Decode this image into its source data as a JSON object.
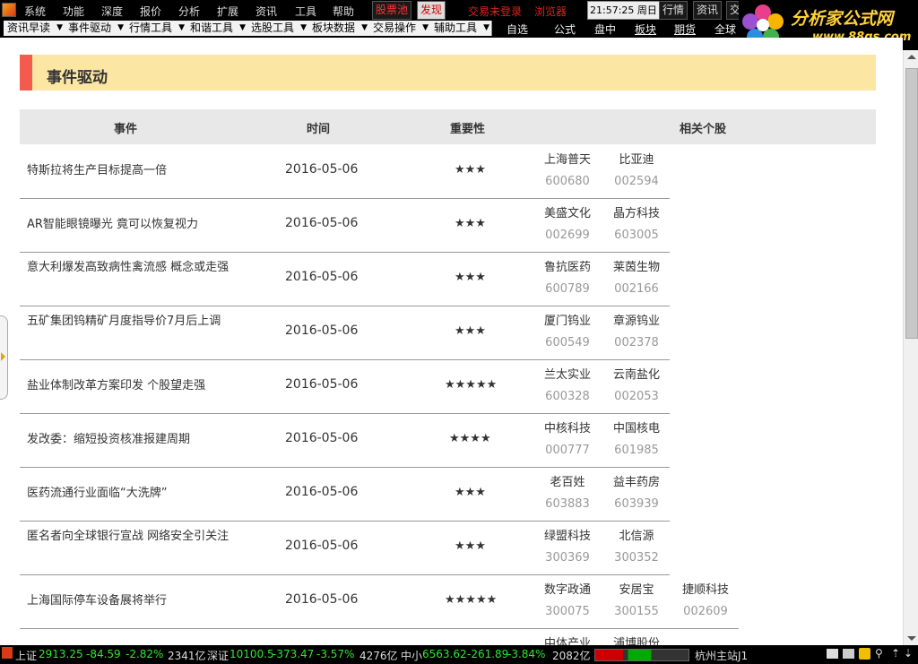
{
  "menubar": {
    "items": [
      "系统",
      "功能",
      "深度",
      "报价",
      "分析",
      "扩展",
      "资讯",
      "工具",
      "帮助"
    ],
    "stock_pool": "股票池",
    "discover": "发现",
    "not_logged": "交易未登录",
    "browser": "浏览器",
    "clock": "21:57:25 周日",
    "market": "行情",
    "news": "资讯",
    "trade_partial": "交"
  },
  "toolbar": {
    "buttons": [
      "资讯早读",
      "事件驱动",
      "行情工具",
      "和谐工具",
      "选股工具",
      "板块数据",
      "交易操作",
      "辅助工具"
    ],
    "links": [
      "自选",
      "公式",
      "盘中",
      "板块",
      "期货",
      "全球"
    ]
  },
  "brand": {
    "name": "分析家公式网",
    "url": "www.88gs.com"
  },
  "section": {
    "title": "事件驱动"
  },
  "table": {
    "headers": [
      "事件",
      "时间",
      "重要性",
      "相关个股"
    ],
    "rows": [
      {
        "event": "特斯拉将生产目标提高一倍",
        "time": "2016-05-06",
        "stars": "★★★",
        "stocks": [
          {
            "name": "上海普天",
            "code": "600680"
          },
          {
            "name": "比亚迪",
            "code": "002594"
          }
        ]
      },
      {
        "event": "AR智能眼镜曝光 竟可以恢复视力",
        "time": "2016-05-06",
        "stars": "★★★",
        "stocks": [
          {
            "name": "美盛文化",
            "code": "002699"
          },
          {
            "name": "晶方科技",
            "code": "603005"
          }
        ]
      },
      {
        "event": "意大利爆发高致病性禽流感 概念或走强",
        "time": "2016-05-06",
        "stars": "★★★",
        "stocks": [
          {
            "name": "鲁抗医药",
            "code": "600789"
          },
          {
            "name": "莱茵生物",
            "code": "002166"
          }
        ]
      },
      {
        "event": "五矿集团钨精矿月度指导价7月后上调",
        "time": "2016-05-06",
        "stars": "★★★",
        "stocks": [
          {
            "name": "厦门钨业",
            "code": "600549"
          },
          {
            "name": "章源钨业",
            "code": "002378"
          }
        ]
      },
      {
        "event": "盐业体制改革方案印发 个股望走强",
        "time": "2016-05-06",
        "stars": "★★★★★",
        "stocks": [
          {
            "name": "兰太实业",
            "code": "600328"
          },
          {
            "name": "云南盐化",
            "code": "002053"
          }
        ]
      },
      {
        "event": "发改委：缩短投资核准报建周期",
        "time": "2016-05-06",
        "stars": "★★★★",
        "stocks": [
          {
            "name": "中核科技",
            "code": "000777"
          },
          {
            "name": "中国核电",
            "code": "601985"
          }
        ]
      },
      {
        "event": "医药流通行业面临“大洗牌”",
        "time": "2016-05-06",
        "stars": "★★★",
        "stocks": [
          {
            "name": "老百姓",
            "code": "603883"
          },
          {
            "name": "益丰药房",
            "code": "603939"
          }
        ]
      },
      {
        "event": "匿名者向全球银行宣战 网络安全引关注",
        "time": "2016-05-06",
        "stars": "★★★",
        "stocks": [
          {
            "name": "绿盟科技",
            "code": "300369"
          },
          {
            "name": "北信源",
            "code": "300352"
          }
        ]
      },
      {
        "event": "上海国际停车设备展将举行",
        "time": "2016-05-06",
        "stars": "★★★★★",
        "stocks": [
          {
            "name": "数字政通",
            "code": "300075"
          },
          {
            "name": "安居宝",
            "code": "300155"
          },
          {
            "name": "捷顺科技",
            "code": "002609"
          }
        ]
      }
    ],
    "partial_row": {
      "stocks": [
        "中体产业",
        "浦博股份"
      ]
    }
  },
  "status": {
    "sh_label": "上证",
    "sh_value": "2913.25",
    "sh_change": "-84.59",
    "sh_pct": "-2.82%",
    "sh_amount": "2341亿",
    "sz_label": "深证",
    "sz_value": "10100.5",
    "sz_change": "-373.47",
    "sz_pct": "-3.57%",
    "sz_amount": "4276亿",
    "zx_label": "中小",
    "zx_value": "6563.62",
    "zx_change": "-261.89",
    "zx_pct": "-3.84%",
    "zx_amount": "2082亿",
    "server": "杭州主站J1"
  }
}
